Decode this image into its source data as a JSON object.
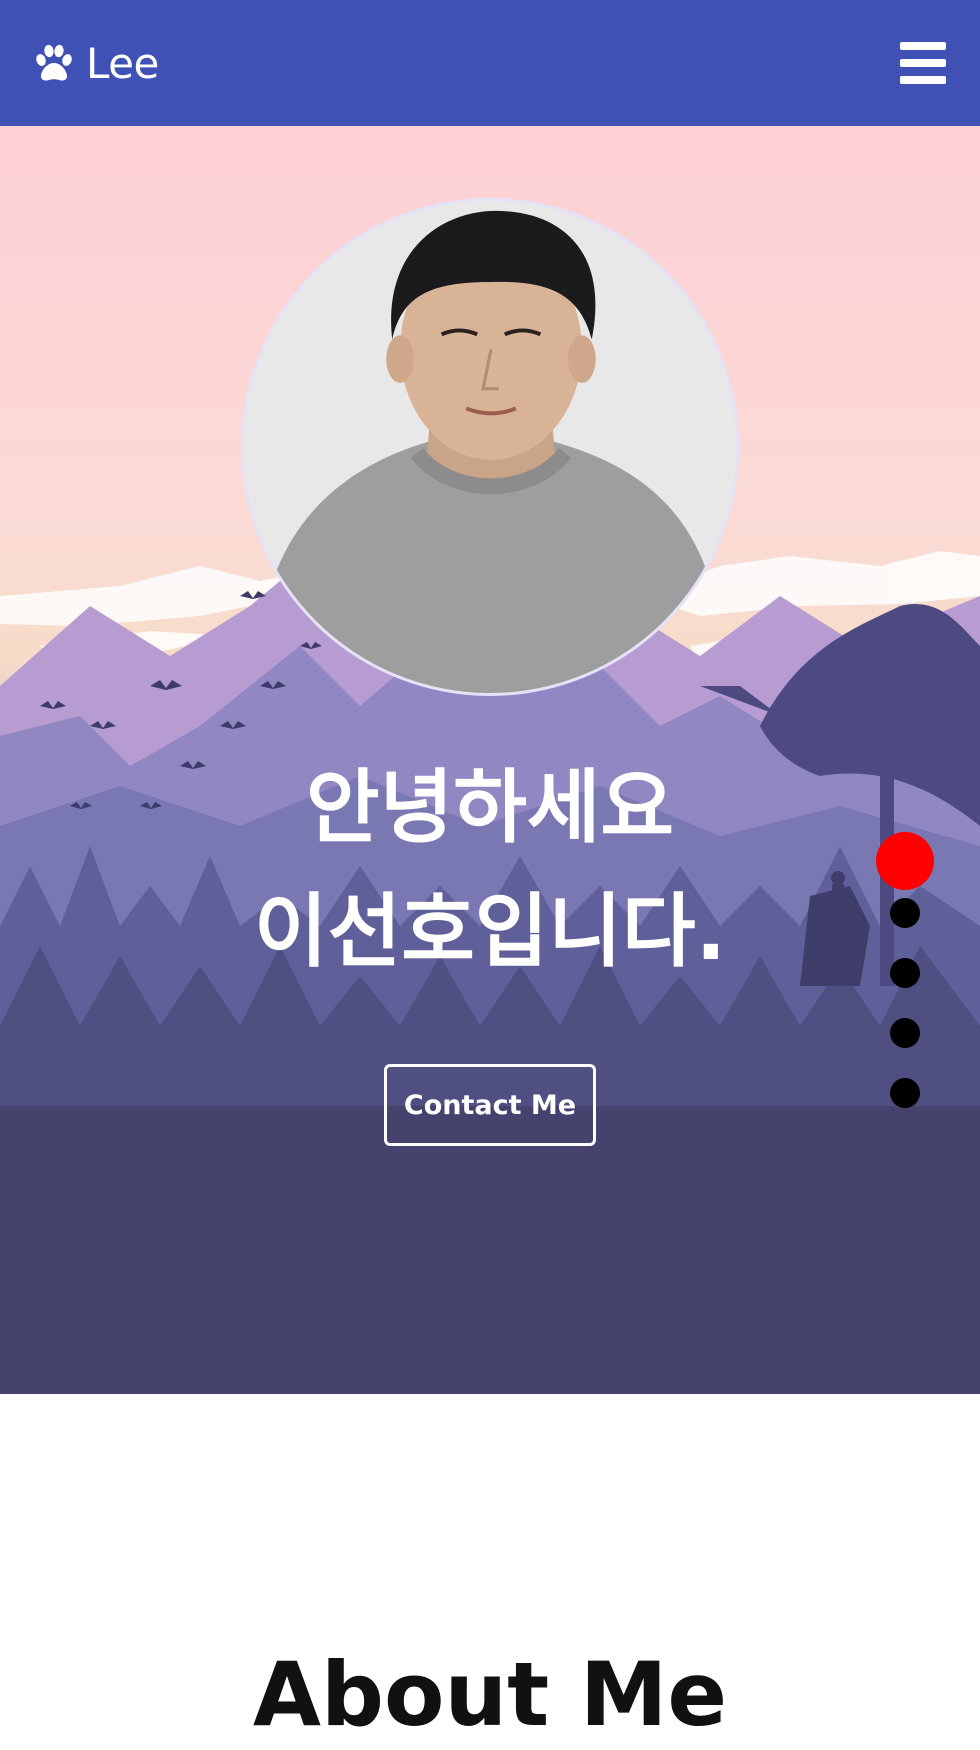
{
  "navbar": {
    "brand_icon": "paw-icon",
    "brand_name": "Lee",
    "menu_icon": "hamburger-menu-icon",
    "background_color": "#3f51b5"
  },
  "hero": {
    "profile_photo": "profile-photo",
    "greeting_line1": "안녕하세요",
    "greeting_line2": "이선호입니다.",
    "contact_button": "Contact Me",
    "section_dots": [
      {
        "active": true,
        "color": "#ff0000"
      },
      {
        "active": false,
        "color": "#000000"
      },
      {
        "active": false,
        "color": "#000000"
      },
      {
        "active": false,
        "color": "#000000"
      },
      {
        "active": false,
        "color": "#000000"
      }
    ]
  },
  "about": {
    "title": "About Me"
  }
}
